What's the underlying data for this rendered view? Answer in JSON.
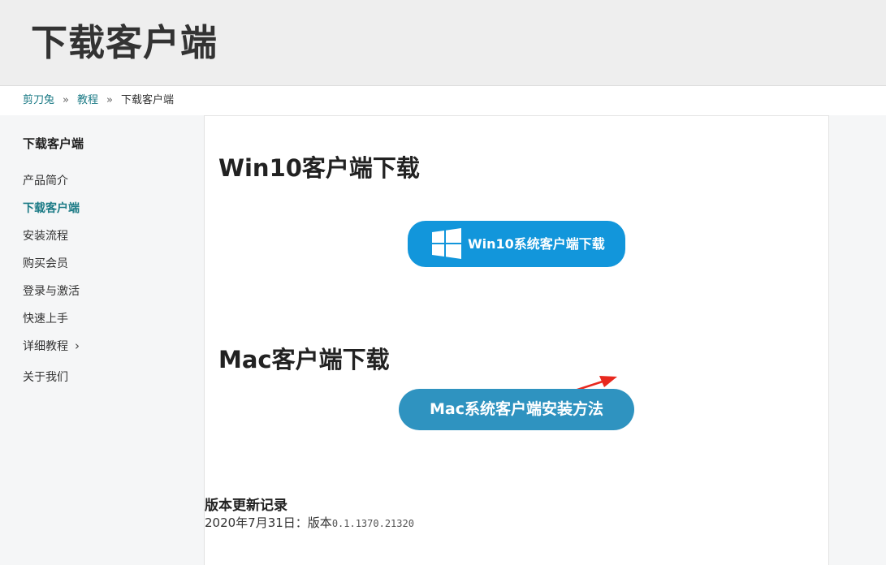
{
  "header": {
    "title": "下载客户端"
  },
  "breadcrumb": {
    "items": [
      "剪刀兔",
      "教程"
    ],
    "separator": "»",
    "current": "下载客户端"
  },
  "sidebar": {
    "title": "下载客户端",
    "items": [
      {
        "label": "产品简介"
      },
      {
        "label": "下载客户端",
        "active": true
      },
      {
        "label": "安装流程"
      },
      {
        "label": "购买会员"
      },
      {
        "label": "登录与激活"
      },
      {
        "label": "快速上手"
      },
      {
        "label": "详细教程",
        "icon": "chevron-right-icon"
      },
      {
        "label": "关于我们"
      }
    ]
  },
  "main": {
    "win_section_title": "Win10客户端下载",
    "win_button_label": "Win10系统客户端下载",
    "win_button_icon": "windows-logo-icon",
    "mac_section_title": "Mac客户端下载",
    "mac_button_label": "Mac系统客户端安装方法",
    "annotation_icon": "red-arrow-icon",
    "log_title": "版本更新记录",
    "log_date_text": "2020年7月31日：版本",
    "log_version": "0.1.1370.21320"
  },
  "colors": {
    "accent": "#1c7b86",
    "win_button": "#1296db",
    "mac_button": "#2f93c0",
    "annotation": "#e8281e"
  }
}
